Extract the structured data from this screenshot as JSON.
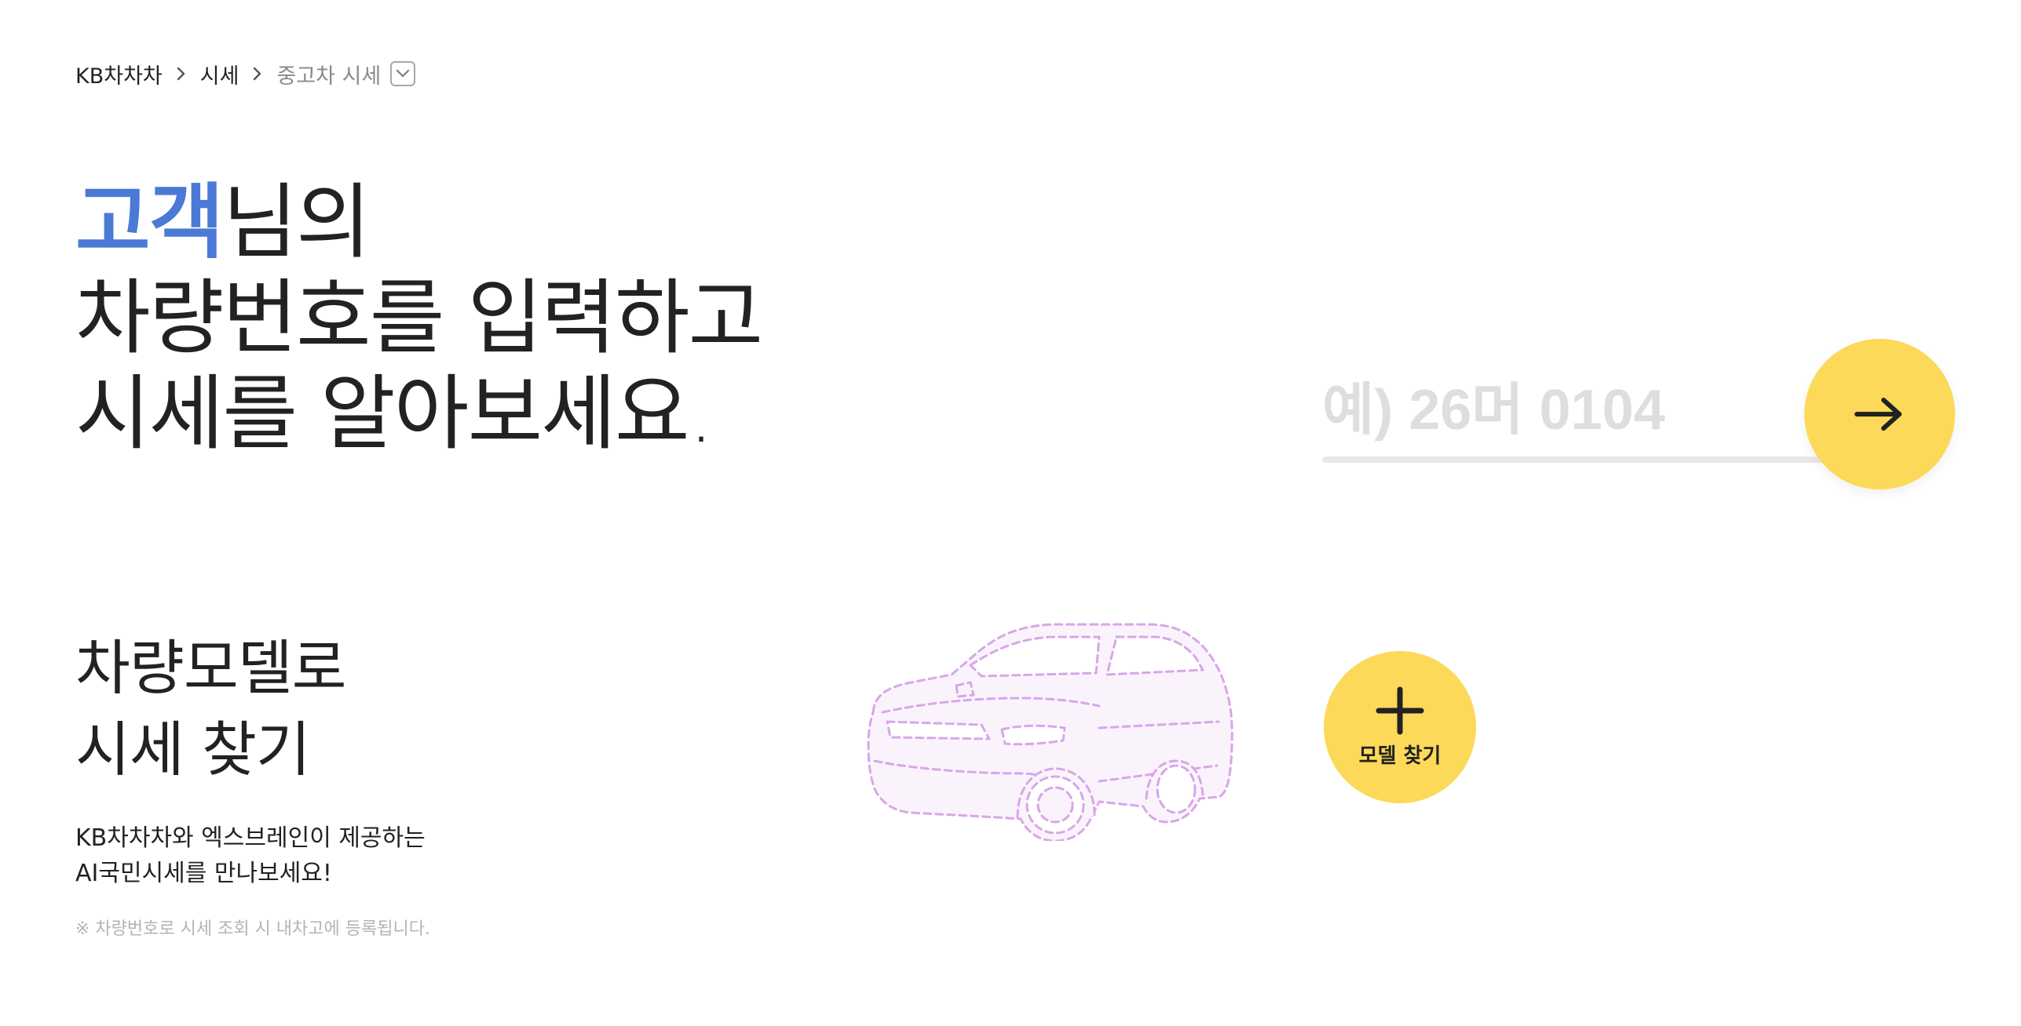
{
  "breadcrumb": {
    "home": "KB차차차",
    "section": "시세",
    "current": "중고차 시세"
  },
  "headline": {
    "highlight": "고객",
    "line1_rest": "님의",
    "line2": "차량번호를 입력하고",
    "line3": "시세를 알아보세요."
  },
  "plate_search": {
    "placeholder": "예) 26머 0104",
    "value": ""
  },
  "model_search": {
    "title_line1": "차량모델로",
    "title_line2": "시세 찾기",
    "description_line1": "KB차차차와 엑스브레인이 제공하는",
    "description_line2": "AI국민시세를 만나보세요!",
    "notice": "※ 차량번호로 시세 조회 시 내차고에 등록됩니다.",
    "button_label": "모델 찾기"
  },
  "colors": {
    "accent_blue": "#4a7ad6",
    "button_yellow": "#fcd958",
    "car_outline": "#d9a6e8"
  },
  "icons": {
    "breadcrumb_separator": "chevron-right-icon",
    "dropdown": "chevron-down-icon",
    "submit": "arrow-right-icon",
    "model": "plus-icon",
    "illustration": "car-outline-illustration"
  }
}
